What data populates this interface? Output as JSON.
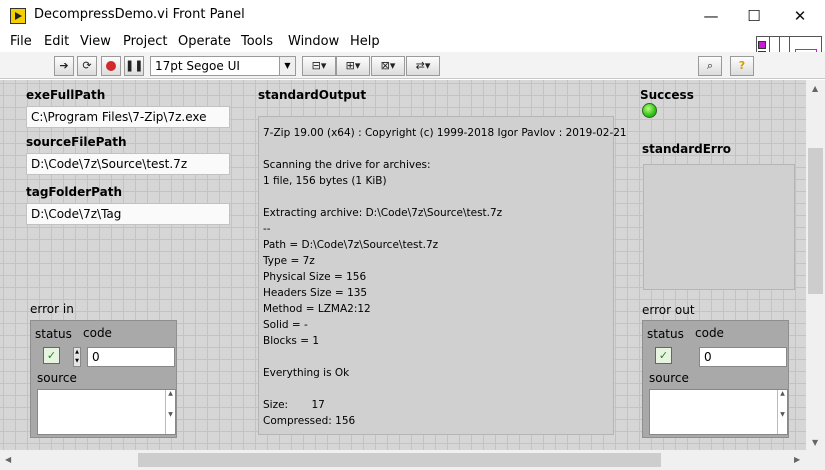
{
  "window": {
    "title": "DecompressDemo.vi Front Panel",
    "icon": "labview-vi-icon",
    "controls": {
      "minimize": "—",
      "maximize": "☐",
      "close": "✕"
    }
  },
  "menu": [
    "File",
    "Edit",
    "View",
    "Project",
    "Operate",
    "Tools",
    "Window",
    "Help"
  ],
  "toolbar": {
    "run_icon": "run-arrow-icon",
    "run_continuous_icon": "run-continuously-icon",
    "abort_icon": "abort-icon",
    "pause_icon": "pause-icon",
    "font": "17pt Segoe UI",
    "search_icon": "search-icon",
    "help_icon": "help-icon"
  },
  "controls": {
    "exeFullPath": {
      "label": "exeFullPath",
      "value": "C:\\Program Files\\7-Zip\\7z.exe"
    },
    "sourceFilePath": {
      "label": "sourceFilePath",
      "value": "D:\\Code\\7z\\Source\\test.7z"
    },
    "tagFolderPath": {
      "label": "tagFolderPath",
      "value": "D:\\Code\\7z\\Tag"
    }
  },
  "standardOutput": {
    "label": "standardOutput",
    "lines": [
      "7-Zip 19.00 (x64) : Copyright (c) 1999-2018 Igor Pavlov : 2019-02-21",
      "",
      "Scanning the drive for archives:",
      "1 file, 156 bytes (1 KiB)",
      "",
      "Extracting archive: D:\\Code\\7z\\Source\\test.7z",
      "--",
      "Path = D:\\Code\\7z\\Source\\test.7z",
      "Type = 7z",
      "Physical Size = 156",
      "Headers Size = 135",
      "Method = LZMA2:12",
      "Solid = -",
      "Blocks = 1",
      "",
      "Everything is Ok",
      "",
      "Size:       17",
      "Compressed: 156"
    ]
  },
  "success": {
    "label": "Success",
    "led_color": "#31c21b"
  },
  "standardError": {
    "label": "standardErro"
  },
  "error_in": {
    "label": "error in",
    "status_label": "status",
    "code_label": "code",
    "source_label": "source",
    "status_mark": "✓",
    "code": "0"
  },
  "error_out": {
    "label": "error out",
    "status_label": "status",
    "code_label": "code",
    "source_label": "source",
    "status_mark": "✓",
    "code": "0"
  },
  "colors": {
    "panel_bg": "#d6d6d6",
    "grid": "#c3c3c3",
    "connector": "#c41bd6"
  }
}
